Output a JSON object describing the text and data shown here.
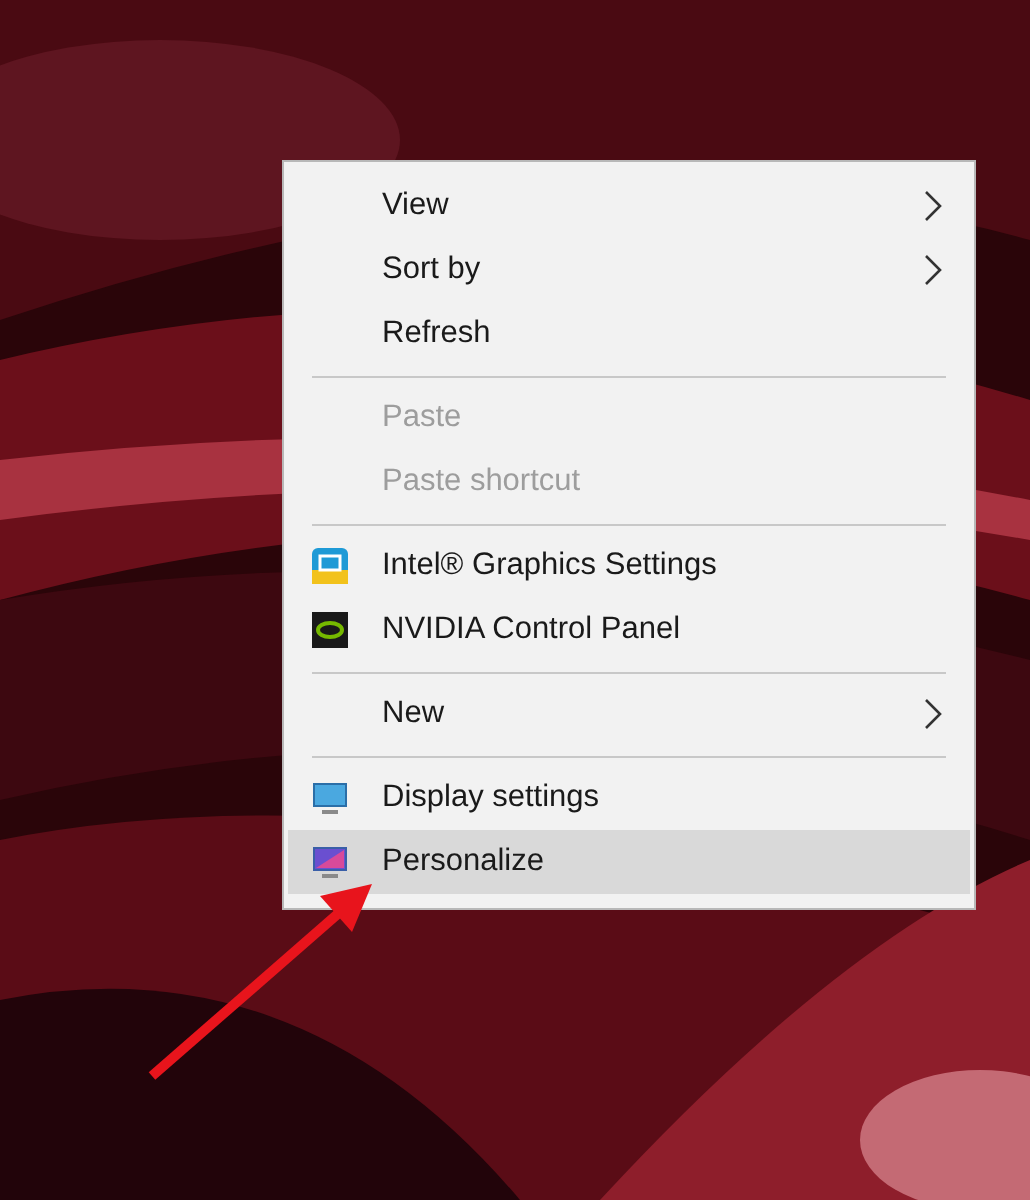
{
  "context_menu": {
    "items": [
      {
        "kind": "item",
        "label": "View",
        "submenu": true,
        "disabled": false,
        "selected": false
      },
      {
        "kind": "item",
        "label": "Sort by",
        "submenu": true,
        "disabled": false,
        "selected": false
      },
      {
        "kind": "item",
        "label": "Refresh",
        "submenu": false,
        "disabled": false,
        "selected": false
      },
      {
        "kind": "separator"
      },
      {
        "kind": "item",
        "label": "Paste",
        "submenu": false,
        "disabled": true,
        "selected": false
      },
      {
        "kind": "item",
        "label": "Paste shortcut",
        "submenu": false,
        "disabled": true,
        "selected": false
      },
      {
        "kind": "separator"
      },
      {
        "kind": "item",
        "label": "Intel® Graphics Settings",
        "submenu": false,
        "disabled": false,
        "selected": false
      },
      {
        "kind": "item",
        "label": "NVIDIA Control Panel",
        "submenu": false,
        "disabled": false,
        "selected": false
      },
      {
        "kind": "separator"
      },
      {
        "kind": "item",
        "label": "New",
        "submenu": true,
        "disabled": false,
        "selected": false
      },
      {
        "kind": "separator"
      },
      {
        "kind": "item",
        "label": "Display settings",
        "submenu": false,
        "disabled": false,
        "selected": false
      },
      {
        "kind": "item",
        "label": "Personalize",
        "submenu": false,
        "disabled": false,
        "selected": true
      }
    ]
  }
}
